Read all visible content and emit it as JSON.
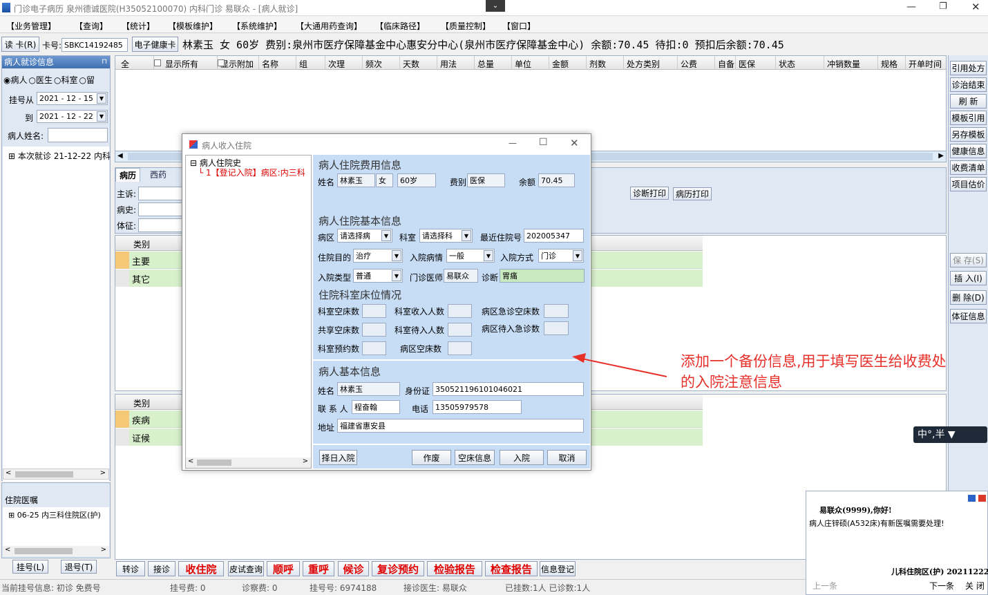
{
  "title_bar": {
    "title": "门诊电子病历  泉州德诚医院(H35052100070)  内科门诊  易联众 - [病人就诊]"
  },
  "menu": [
    "【业务管理】",
    "【查询】",
    "【统计】",
    "【模板维护】",
    "【系统维护】",
    "【大通用药查询】",
    "【临床路径】",
    "【质量控制】",
    "【窗口】"
  ],
  "infobar": {
    "read_card": "读 卡(R)",
    "card_label": "卡号:",
    "card_value": "SBKC14192485",
    "ehealth": "电子健康卡",
    "patient_info": "林素玉  女  60岁  费别:泉州市医疗保障基金中心惠安分中心(泉州市医疗保障基金中心) 余额:70.45  待扣:0  预扣后余额:70.45"
  },
  "left_panel": {
    "header": "病人就诊信息",
    "radios": [
      "病人",
      "医生",
      "科室",
      "留"
    ],
    "reg_from_label": "挂号从",
    "reg_from": "2021 - 12 - 15",
    "to_label": "到",
    "reg_to": "2021 - 12 - 22",
    "name_label": "病人姓名:",
    "tree_item": "本次就诊 21-12-22 内科",
    "inpatient_header": "住院医嘱",
    "inpatient_item": "06-25 内三科住院区(护)",
    "reg_btn": "挂号(L)",
    "unreg_btn": "退号(T)"
  },
  "grid_headers": [
    "全",
    "显示所有",
    "显示附加",
    "名称",
    "组",
    "次理",
    "频次",
    "天数",
    "用法",
    "总量",
    "单位",
    "金额",
    "剂数",
    "处方类别",
    "公费",
    "自备",
    "医保",
    "状态",
    "冲销数量",
    "规格",
    "开单时间"
  ],
  "tabs": [
    "病历",
    "西药"
  ],
  "record_fields": [
    "主诉:",
    "病史:",
    "体征:"
  ],
  "diag_table1": {
    "header": "类别",
    "rows": [
      "主要",
      "其它"
    ]
  },
  "diag_table2": {
    "header": "类别",
    "rows": [
      "疾病",
      "证候"
    ]
  },
  "print_buttons": [
    "诊断打印",
    "病历打印"
  ],
  "right_buttons": [
    "引用处方",
    "诊治结束",
    "刷 新",
    "模板引用",
    "另存模板",
    "健康信息",
    "收费清单",
    "项目估价",
    "保 存(S)",
    "插 入(I)",
    "删 除(D)",
    "体征信息"
  ],
  "bottom_buttons": [
    {
      "label": "转诊",
      "red": false
    },
    {
      "label": "接诊",
      "red": false
    },
    {
      "label": "收住院",
      "red": true
    },
    {
      "label": "皮试查询",
      "red": false
    },
    {
      "label": "顺呼",
      "red": true
    },
    {
      "label": "重呼",
      "red": true
    },
    {
      "label": "候诊",
      "red": true
    },
    {
      "label": "复诊预约",
      "red": true
    },
    {
      "label": "检验报告",
      "red": true
    },
    {
      "label": "检查报告",
      "red": true
    },
    {
      "label": "信息登记",
      "red": false
    }
  ],
  "status_bar": {
    "s1": "当前挂号信息:  初诊 免费号",
    "s2": "挂号费:  0",
    "s3": "诊察费:  0",
    "s4": "挂号号:  6974188",
    "s5": "接诊医生:  易联众",
    "s6": "已挂数:1人  已诊数:1人"
  },
  "dialog": {
    "title": "病人收入住院",
    "tree_root": "病人住院史",
    "tree_child": "1【登记入院】病区:内三科",
    "fee_section": "病人住院费用信息",
    "name_label": "姓名",
    "name": "林素玉",
    "sex": "女",
    "age": "60岁",
    "fee_type_label": "费别",
    "fee_type": "医保",
    "balance_label": "余额",
    "balance": "70.45",
    "basic_section": "病人住院基本信息",
    "ward_label": "病区",
    "ward": "请选择病",
    "dept_label": "科室",
    "dept": "请选择科",
    "last_no_label": "最近住院号",
    "last_no": "202005347",
    "purpose_label": "住院目的",
    "purpose": "治疗",
    "condition_label": "入院病情",
    "condition": "一般",
    "method_label": "入院方式",
    "method": "门诊",
    "type_label": "入院类型",
    "type": "普通",
    "doctor_label": "门诊医师",
    "doctor": "易联众",
    "diag_label": "诊断",
    "diag": "胃痛",
    "bed_section": "住院科室床位情况",
    "bed_labels": [
      "科室空床数",
      "科室收入人数",
      "病区急诊空床数",
      "共享空床数",
      "科室待入人数",
      "病区待入急诊数",
      "科室预约数",
      "病区空床数"
    ],
    "person_section": "病人基本信息",
    "p_name_label": "姓名",
    "p_name": "林素玉",
    "id_label": "身份证",
    "id": "350521196101046021",
    "contact_label": "联 系 人",
    "contact": "程奋翰",
    "phone_label": "电话",
    "phone": "13505979578",
    "addr_label": "地址",
    "addr": "福建省惠安县",
    "buttons": [
      "择日入院",
      "作废",
      "空床信息",
      "入院",
      "取消"
    ]
  },
  "annotation": {
    "line1": "添加一个备份信息,用于填写医生给收费处",
    "line2": "的入院注意信息",
    "color": "#e8302a"
  },
  "ime": {
    "text": "中°,半"
  },
  "popup": {
    "greeting": "易联众(9999),你好!",
    "message": "病人庄锌硕(A532床)有新医嘱需要处理!",
    "footer": "儿科住院区(护) 20211222",
    "prev": "上一条",
    "next": "下一条",
    "close": "关 闭"
  }
}
